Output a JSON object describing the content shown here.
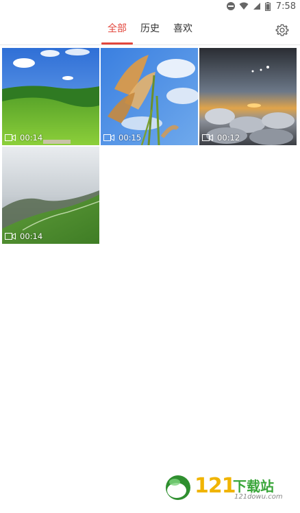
{
  "status_bar": {
    "time": "7:58"
  },
  "tabs": [
    {
      "label": "全部",
      "active": true
    },
    {
      "label": "历史",
      "active": false
    },
    {
      "label": "喜欢",
      "active": false
    }
  ],
  "accent_color": "#e2463c",
  "settings_icon": "gear-icon",
  "videos": [
    {
      "duration": "00:14",
      "scene": "green hills under blue sky"
    },
    {
      "duration": "00:15",
      "scene": "reed grass against sky"
    },
    {
      "duration": "00:12",
      "scene": "sunset above clouds"
    },
    {
      "duration": "00:14",
      "scene": "misty green mountain ridge"
    }
  ],
  "watermark": {
    "number": "121",
    "text": "下载站",
    "sub": "121dowu.com"
  }
}
